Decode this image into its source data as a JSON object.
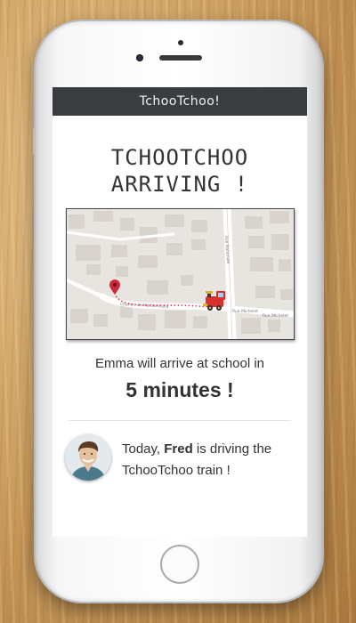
{
  "app": {
    "navbar_title": "TchooTchoo!"
  },
  "headline": {
    "line1": "TCHOOTCHOO",
    "line2": "ARRIVING !"
  },
  "map": {
    "street_labels": [
      "Rue Michelet",
      "Rue Michelet",
      "Chemin de Marbambara",
      "Rue Nationale"
    ]
  },
  "arrival": {
    "text": "Emma will arrive at school in",
    "eta": "5 minutes !"
  },
  "driver": {
    "prefix": "Today, ",
    "name": "Fred",
    "suffix": " is driving the TchooTchoo train !"
  },
  "colors": {
    "navbar_bg": "#3a3d40",
    "route_dots": "#c2344a",
    "pin": "#d0283a"
  }
}
